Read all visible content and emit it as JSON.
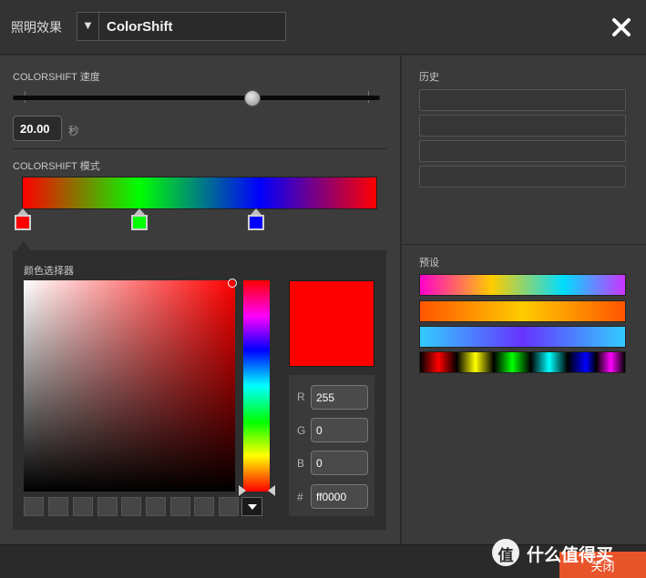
{
  "header": {
    "label": "照明效果",
    "effect_selected": "ColorShift",
    "close_icon": "close-x-icon"
  },
  "speed": {
    "label": "COLORSHIFT 速度",
    "slider_position_fraction": 0.63,
    "value": "20.00",
    "unit": "秒"
  },
  "pattern": {
    "label": "COLORSHIFT 模式",
    "gradient_stops": [
      "#ff0000",
      "#00ff00",
      "#0000ff",
      "#ff0000"
    ],
    "markers": [
      {
        "color": "#ff0000",
        "selected": true
      },
      {
        "color": "#00ff00",
        "selected": false
      },
      {
        "color": "#0000ff",
        "selected": false
      }
    ]
  },
  "color_picker": {
    "label": "颜色选择器",
    "preview_color": "#ff0000",
    "r_label": "R",
    "r_value": "255",
    "g_label": "G",
    "g_value": "0",
    "b_label": "B",
    "b_value": "0",
    "hex_label": "#",
    "hex_value": "ff0000",
    "recent_swatch_count": 9
  },
  "history": {
    "label": "历史",
    "slots": 4
  },
  "presets": {
    "label": "预设",
    "items": [
      "rainbow-pastel",
      "orange-gold",
      "cyan-violet",
      "spectrum-blocks"
    ]
  },
  "footer": {
    "close_label": "关闭"
  },
  "watermark": {
    "logo_glyph": "值",
    "text": "什么值得买"
  }
}
